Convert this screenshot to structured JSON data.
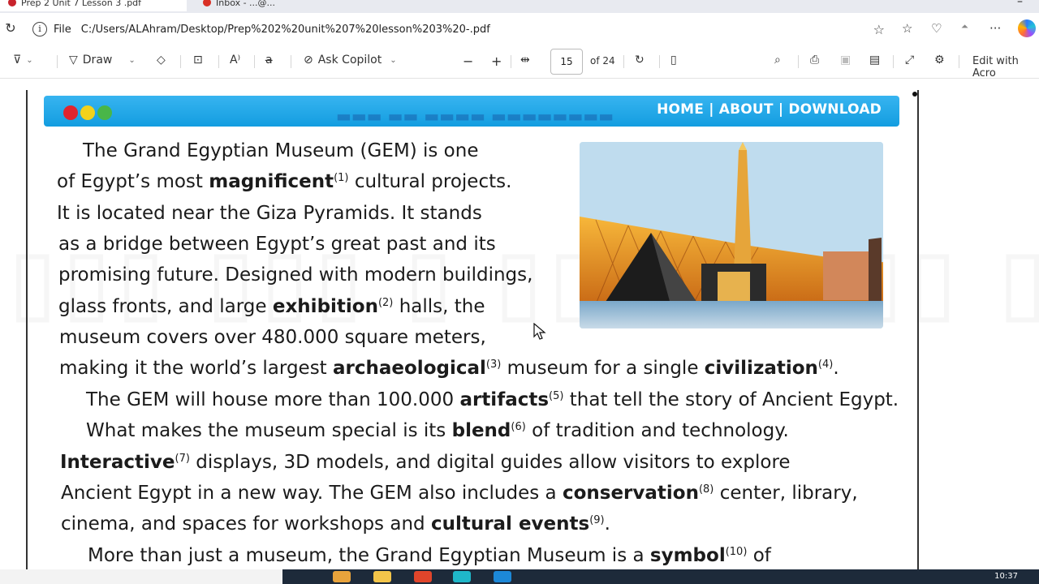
{
  "browser": {
    "tabs": [
      {
        "label": "Prep 2 Unit 7 Lesson 3 .pdf"
      },
      {
        "label": "Inbox - ...@..."
      }
    ],
    "url_scheme": "File",
    "url": "C:/Users/ALAhram/Desktop/Prep%202%20unit%207%20lesson%203%20-.pdf"
  },
  "pdf_toolbar": {
    "draw_label": "Draw",
    "ask_copilot_label": "Ask Copilot",
    "page_number": "15",
    "page_total": "of 24",
    "edit_label": "Edit with Acro"
  },
  "document": {
    "banner": {
      "nav": "HOME | ABOUT | DOWNLOAD",
      "colors": [
        "#e0242e",
        "#f2d21b",
        "#49b648"
      ],
      "accent": "#1ba6e6"
    },
    "paragraph_lines": [
      {
        "parts": [
          {
            "t": "The Grand Egyptian Museum (GEM) is one"
          }
        ]
      },
      {
        "parts": [
          {
            "t": "of Egypt’s most "
          },
          {
            "t": "magnificent",
            "b": true
          },
          {
            "t": "(1)",
            "sup": true
          },
          {
            "t": " cultural projects."
          }
        ]
      },
      {
        "parts": [
          {
            "t": "It is located near the Giza Pyramids. It stands"
          }
        ]
      },
      {
        "parts": [
          {
            "t": "as a bridge between Egypt’s great past and its"
          }
        ]
      },
      {
        "parts": [
          {
            "t": "promising future. Designed with modern buildings,"
          }
        ]
      },
      {
        "parts": [
          {
            "t": "glass fronts, and large "
          },
          {
            "t": "exhibition",
            "b": true
          },
          {
            "t": "(2)",
            "sup": true
          },
          {
            "t": " halls, the"
          }
        ]
      },
      {
        "parts": [
          {
            "t": "museum covers over 480.000 square meters,"
          }
        ]
      },
      {
        "parts": [
          {
            "t": "making it the world’s largest "
          },
          {
            "t": "archaeological",
            "b": true
          },
          {
            "t": "(3)",
            "sup": true
          },
          {
            "t": " museum for a single "
          },
          {
            "t": "civilization",
            "b": true
          },
          {
            "t": "(4)",
            "sup": true
          },
          {
            "t": "."
          }
        ]
      },
      {
        "parts": [
          {
            "t": "The GEM will house more than 100.000 "
          },
          {
            "t": "artifacts",
            "b": true
          },
          {
            "t": "(5)",
            "sup": true
          },
          {
            "t": " that tell the story of Ancient Egypt."
          }
        ]
      },
      {
        "parts": [
          {
            "t": "What makes the museum special is its "
          },
          {
            "t": "blend",
            "b": true
          },
          {
            "t": "(6)",
            "sup": true
          },
          {
            "t": " of tradition and technology."
          }
        ]
      },
      {
        "parts": [
          {
            "t": "Interactive",
            "b": true
          },
          {
            "t": "(7)",
            "sup": true
          },
          {
            "t": " displays, 3D models, and digital guides allow visitors to explore"
          }
        ]
      },
      {
        "parts": [
          {
            "t": "Ancient Egypt in a new way. The GEM also includes a "
          },
          {
            "t": "conservation",
            "b": true
          },
          {
            "t": "(8)",
            "sup": true
          },
          {
            "t": " center, library,"
          }
        ]
      },
      {
        "parts": [
          {
            "t": "cinema, and spaces for workshops and "
          },
          {
            "t": "cultural events",
            "b": true
          },
          {
            "t": "(9)",
            "sup": true
          },
          {
            "t": "."
          }
        ]
      },
      {
        "parts": [
          {
            "t": "More than just a museum, the Grand Egyptian Museum is a "
          },
          {
            "t": "symbol",
            "b": true
          },
          {
            "t": "(10)",
            "sup": true
          },
          {
            "t": " of"
          }
        ]
      }
    ]
  },
  "taskbar": {
    "time": "10:37"
  }
}
